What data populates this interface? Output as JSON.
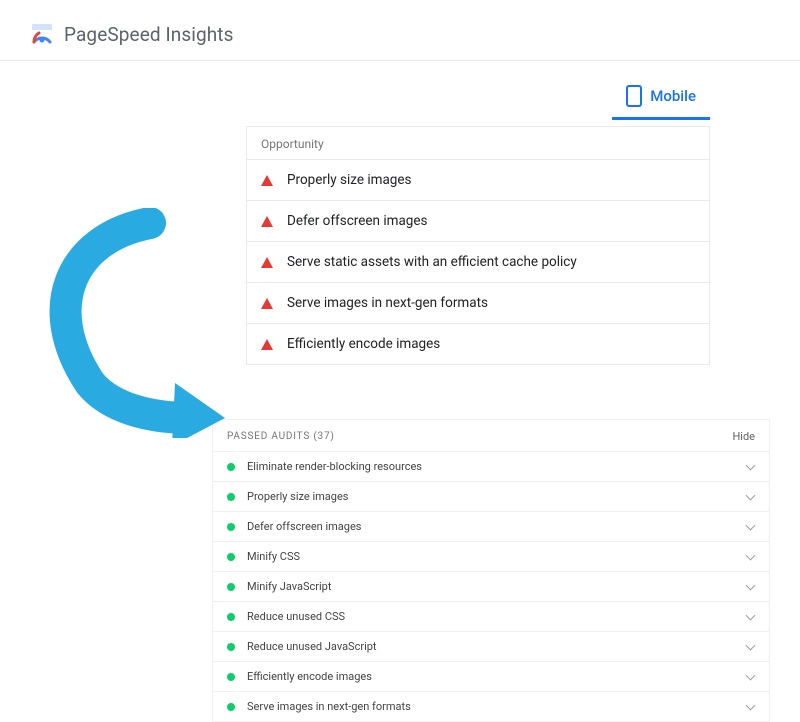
{
  "header": {
    "title": "PageSpeed Insights"
  },
  "tab": {
    "label": "Mobile"
  },
  "opportunity": {
    "title": "Opportunity",
    "items": [
      {
        "label": "Properly size images"
      },
      {
        "label": "Defer offscreen images"
      },
      {
        "label": "Serve static assets with an efficient cache policy"
      },
      {
        "label": "Serve images in next-gen formats"
      },
      {
        "label": "Efficiently encode images"
      }
    ]
  },
  "passed": {
    "title": "PASSED AUDITS (37)",
    "hide_label": "Hide",
    "items": [
      {
        "label": "Eliminate render-blocking resources"
      },
      {
        "label": "Properly size images"
      },
      {
        "label": "Defer offscreen images"
      },
      {
        "label": "Minify CSS"
      },
      {
        "label": "Minify JavaScript"
      },
      {
        "label": "Reduce unused CSS"
      },
      {
        "label": "Reduce unused JavaScript"
      },
      {
        "label": "Efficiently encode images"
      },
      {
        "label": "Serve images in next-gen formats"
      }
    ]
  }
}
